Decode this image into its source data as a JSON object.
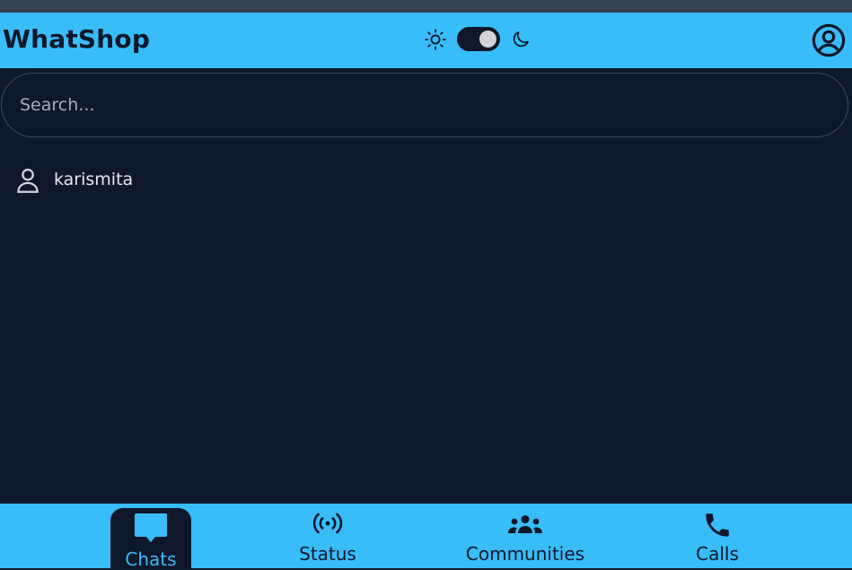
{
  "app": {
    "title": "WhatShop"
  },
  "header": {
    "theme_toggle": {
      "state": "dark"
    },
    "icons": {
      "light": "sun-icon",
      "dark": "moon-icon",
      "profile": "user-circle-icon"
    }
  },
  "search": {
    "placeholder": "Search..."
  },
  "contacts": [
    {
      "name": "karismita",
      "icon": "user-icon"
    }
  ],
  "bottom_nav": {
    "items": [
      {
        "label": "Chats",
        "icon": "chat-bubble-icon",
        "active": true
      },
      {
        "label": "Status",
        "icon": "broadcast-icon",
        "active": false
      },
      {
        "label": "Communities",
        "icon": "users-group-icon",
        "active": false
      },
      {
        "label": "Calls",
        "icon": "phone-icon",
        "active": false
      }
    ]
  },
  "colors": {
    "accent": "#38bdf8",
    "background": "#0f172a",
    "text_dark": "#0f172a",
    "text_light": "#e5e7eb"
  }
}
